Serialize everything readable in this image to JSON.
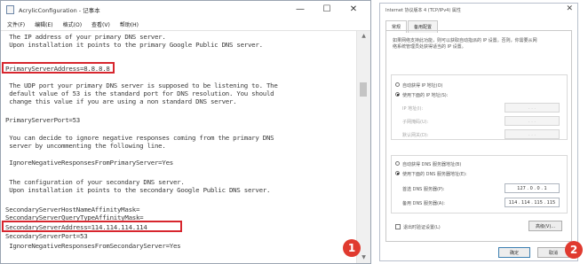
{
  "notepad": {
    "title": "AcrylicConfiguration - 记事本",
    "controls": {
      "minimize": "—",
      "maximize": "☐",
      "close": "✕"
    },
    "menu": [
      "文件(F)",
      "编辑(E)",
      "格式(O)",
      "查看(V)",
      "帮助(H)"
    ],
    "lines": [
      " The IP address of your primary DNS server.",
      " Upon installation it points to the primary Google Public DNS server.",
      "",
      "PrimaryServerAddress=8.8.8.8",
      "",
      " The UDP port your primary DNS server is supposed to be listening to. The",
      " default value of 53 is the standard port for DNS resolution. You should",
      " change this value if you are using a non standard DNS server.",
      "",
      "PrimaryServerPort=53",
      "",
      " You can decide to ignore negative responses coming from the primary DNS",
      " server by uncommenting the following line.",
      "",
      " IgnoreNegativeResponsesFromPrimaryServer=Yes",
      "",
      " The configuration of your secondary DNS server.",
      " Upon installation it points to the secondary Google Public DNS server.",
      "",
      "SecondaryServerHostNameAffinityMask=",
      "SecondaryServerQueryTypeAffinityMask=",
      "SecondaryServerAddress=114.114.114.114",
      "SecondaryServerPort=53",
      " IgnoreNegativeResponsesFromSecondaryServer=Yes"
    ],
    "scroll_arrows": {
      "up": "▲",
      "down": "▼"
    }
  },
  "dialog": {
    "title": "Internet 协议版本 4 (TCP/IPv4) 属性",
    "close": "✕",
    "tabs": [
      "常规",
      "备用配置"
    ],
    "description_1": "如果网络支持此功能，则可以获取自动指派的 IP 设置。否则，你需要从网",
    "description_2": "络系统管理员处获得适当的 IP 设置。",
    "radio_auto_ip": "自动获得 IP 地址(O)",
    "radio_manual_ip": "使用下面的 IP 地址(S):",
    "ip_address_label": "IP 地址(I):",
    "subnet_label": "子网掩码(U):",
    "gateway_label": "默认网关(D):",
    "empty_ip": ".   .   .",
    "radio_auto_dns": "自动获得 DNS 服务器地址(B)",
    "radio_manual_dns": "使用下面的 DNS 服务器地址(E):",
    "preferred_dns_label": "首选 DNS 服务器(P):",
    "preferred_dns_value": "127 .  0  .  0  .  1",
    "alternate_dns_label": "备用 DNS 服务器(A):",
    "alternate_dns_value": "114 . 114 . 115 . 115",
    "validate_checkbox": "退出时验证设置(L)",
    "advanced_button": "高级(V)...",
    "ok_button": "确定",
    "cancel_button": "取消"
  },
  "badges": {
    "left": "1",
    "right": "2"
  },
  "colors": {
    "highlight": "#d7262e",
    "badge": "#e03a2f"
  }
}
